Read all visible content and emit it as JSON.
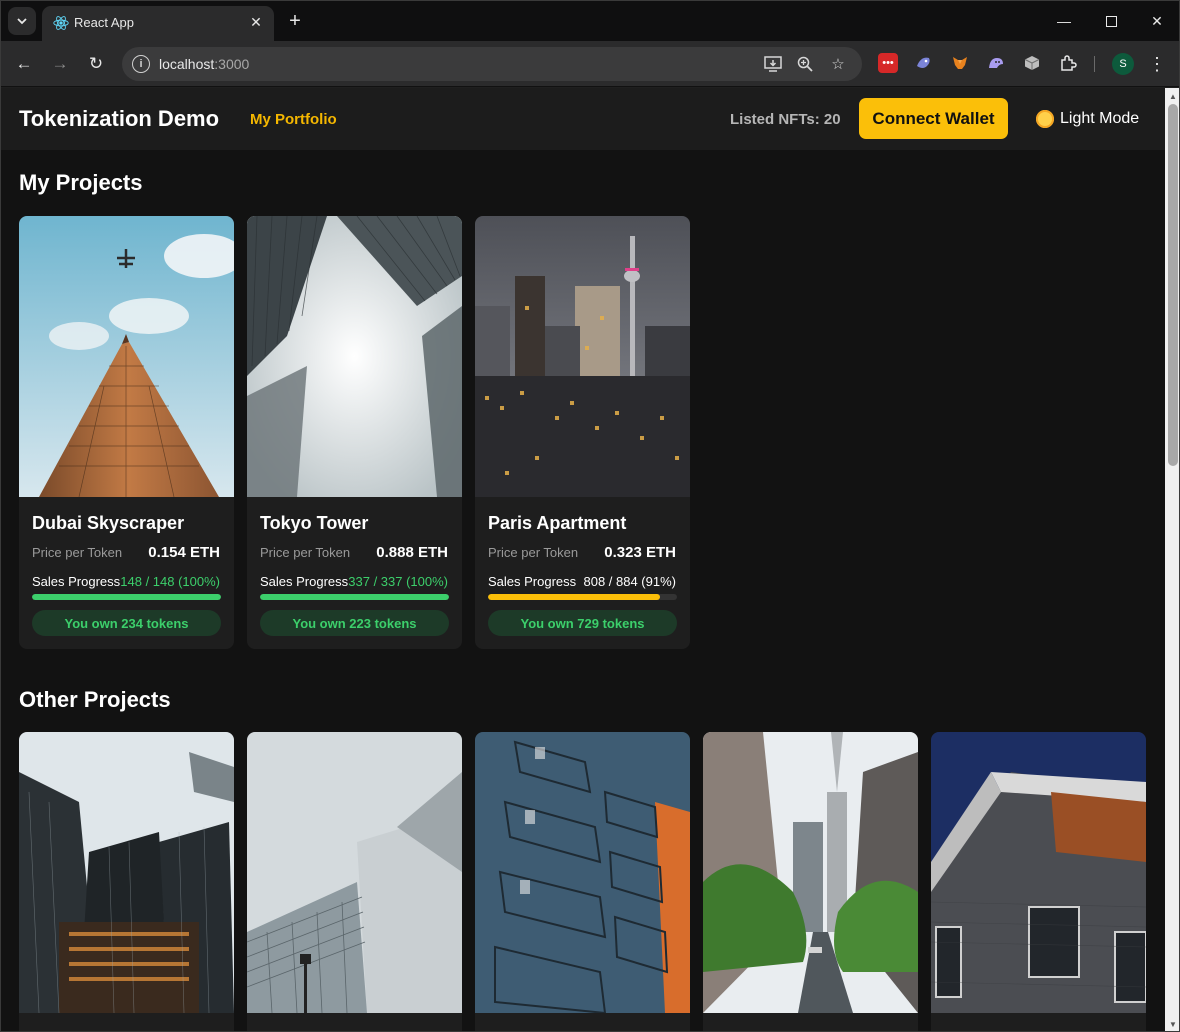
{
  "browser": {
    "tab_title": "React App",
    "url_host": "localhost",
    "url_port": ":3000",
    "profile_initial": "S"
  },
  "header": {
    "brand": "Tokenization Demo",
    "nav_link": "My Portfolio",
    "listed": "Listed NFTs: 20",
    "connect_label": "Connect Wallet",
    "mode_label": "Light Mode"
  },
  "sections": {
    "my_projects": "My Projects",
    "other_projects": "Other Projects"
  },
  "labels": {
    "price_per_token": "Price per Token",
    "sales_progress": "Sales Progress"
  },
  "my_projects": [
    {
      "name": "Dubai Skyscraper",
      "price": "0.154 ETH",
      "sales": "148 / 148 (100%)",
      "progress": 1.0,
      "bar_color": "#3ccf6b",
      "sales_color": "#3ccf6b",
      "own": "You own 234 tokens"
    },
    {
      "name": "Tokyo Tower",
      "price": "0.888 ETH",
      "sales": "337 / 337 (100%)",
      "progress": 1.0,
      "bar_color": "#3ccf6b",
      "sales_color": "#3ccf6b",
      "own": "You own 223 tokens"
    },
    {
      "name": "Paris Apartment",
      "price": "0.323 ETH",
      "sales": "808 / 884 (91%)",
      "progress": 0.91,
      "bar_color": "#fbbf09",
      "sales_color": "#ffffff",
      "own": "You own 729 tokens"
    }
  ],
  "colors": {
    "accent": "#fbbf09",
    "success": "#3ccf6b",
    "background": "#121212"
  }
}
